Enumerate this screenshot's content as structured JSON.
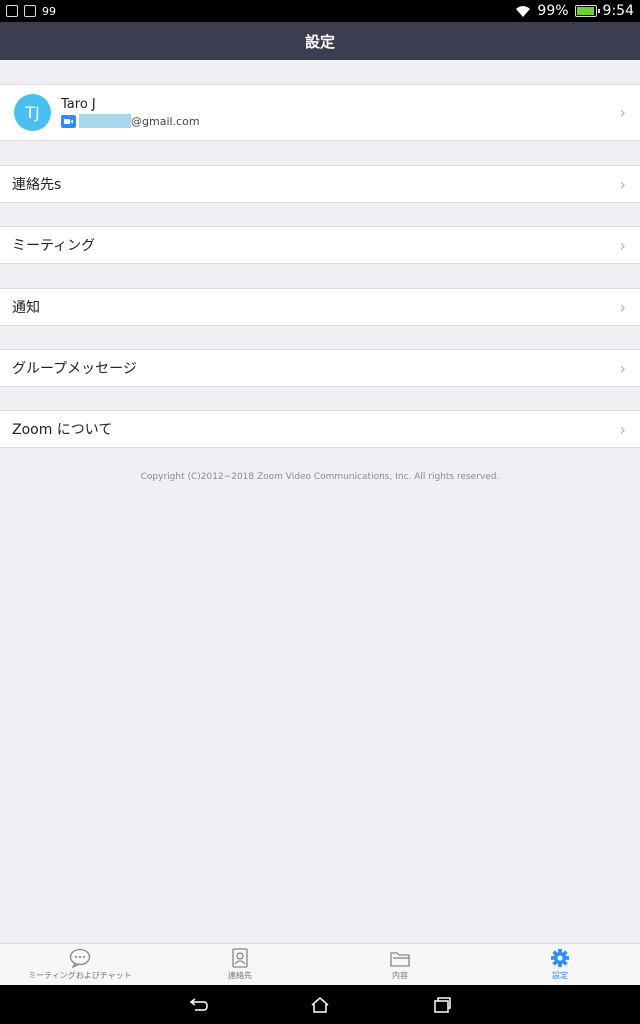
{
  "status_bar": {
    "left_text": "99",
    "battery_percent": "99%",
    "time": "9:54"
  },
  "header": {
    "title": "設定"
  },
  "profile": {
    "avatar_initials": "TJ",
    "name": "Taro J",
    "email_suffix": "@gmail.com"
  },
  "menu": [
    {
      "label": "連絡先s"
    },
    {
      "label": "ミーティング"
    },
    {
      "label": "通知"
    },
    {
      "label": "グループメッセージ"
    },
    {
      "label": "Zoom について"
    }
  ],
  "copyright": "Copyright (C)2012−2018 Zoom Video Communications, Inc. All rights reserved.",
  "tabs": [
    {
      "label": "ミーティングおよびチャット",
      "icon": "chat-bubble-icon"
    },
    {
      "label": "連絡先",
      "icon": "contacts-icon"
    },
    {
      "label": "内容",
      "icon": "folder-icon"
    },
    {
      "label": "設定",
      "icon": "gear-icon"
    }
  ],
  "colors": {
    "header": "#3d3d52",
    "accent": "#2d8cff",
    "avatar": "#4ac0f0"
  }
}
